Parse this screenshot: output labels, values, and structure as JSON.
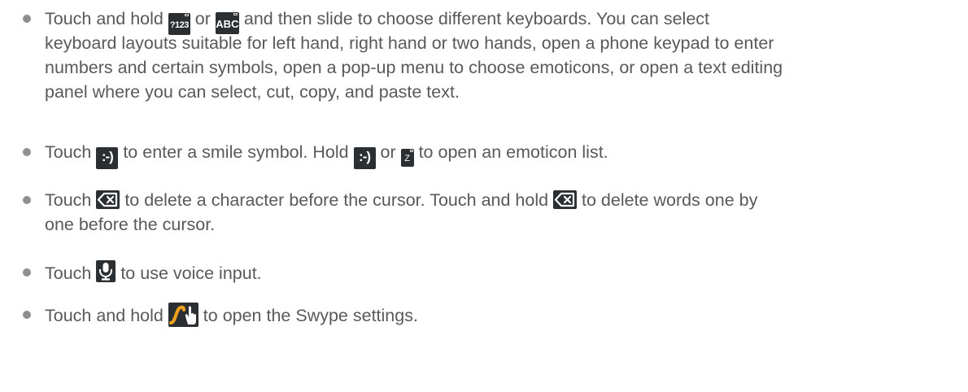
{
  "items": [
    {
      "lines": [
        {
          "part1": "Touch and hold ",
          "icon1": "?123",
          "part2": " or ",
          "icon2": "ABC",
          "part3": " and then slide to choose different keyboards. You can select"
        },
        {
          "text": "keyboard layouts suitable for left hand, right hand or two hands, open a phone keypad to enter"
        },
        {
          "text": "numbers and certain symbols, open a pop-up menu to choose emoticons, or open a text editing"
        },
        {
          "text": "panel where you can select, cut, copy, and paste text."
        }
      ]
    },
    {
      "part1": "Touch ",
      "icon1": ":-)",
      "part2": " to enter a smile symbol. Hold ",
      "icon2": ":-)",
      "part3": " or ",
      "icon3": "Z",
      "part4": " to open an emoticon list."
    },
    {
      "part1": "Touch ",
      "icon1": "backspace-icon",
      "part2": " to delete a character before the cursor. Touch and hold ",
      "icon2": "backspace-icon",
      "part3": " to delete words one by",
      "line2": "one before the cursor."
    },
    {
      "part1": "Touch ",
      "icon1": "microphone-icon",
      "part2": " to use voice input."
    },
    {
      "part1": "Touch and hold ",
      "icon1": "swype-icon",
      "part2": " to open the Swype settings."
    }
  ],
  "colors": {
    "text": "#595959",
    "bullet": "#8f8f8f",
    "key_background": "#2b2f31",
    "key_icon": "#ffffff",
    "swype_orange": "#f0a21a"
  }
}
